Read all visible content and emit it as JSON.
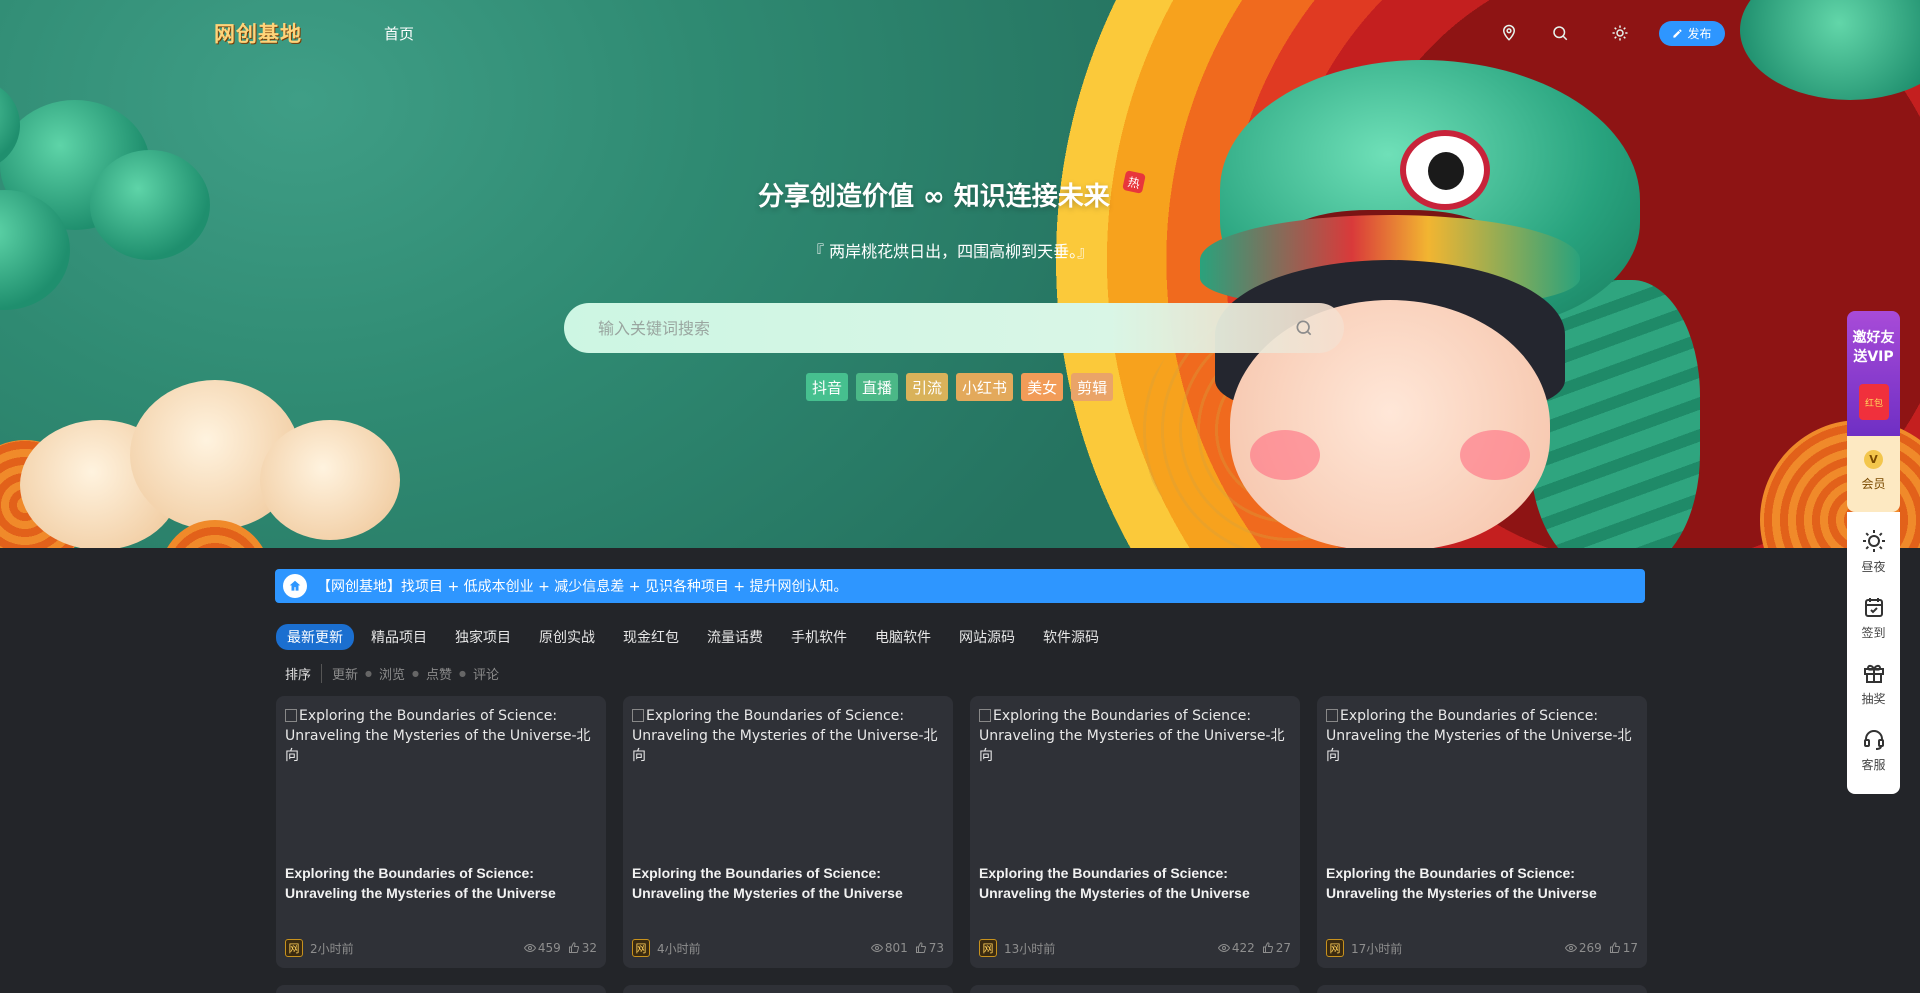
{
  "site": {
    "logo": "网创基地",
    "nav": {
      "home": "首页"
    },
    "publish_label": "发布",
    "publish_color": "#2e96ff"
  },
  "hero": {
    "title": "分享创造价值 ∞ 知识连接未来",
    "hot_badge": "热",
    "subtitle": "『 两岸桃花烘日出，四围高柳到天垂。』",
    "search_placeholder": "输入关键词搜索",
    "hot_tags": [
      {
        "label": "抖音",
        "color": "#46c08f"
      },
      {
        "label": "直播",
        "color": "#4bb887"
      },
      {
        "label": "引流",
        "color": "#d9b25a"
      },
      {
        "label": "小红书",
        "color": "#e3a95b"
      },
      {
        "label": "美女",
        "color": "#f29c58"
      },
      {
        "label": "剪辑",
        "color": "#eaa468"
      }
    ]
  },
  "notice": {
    "text": "【网创基地】找项目 + 低成本创业 + 减少信息差 + 见识各种项目 + 提升网创认知。",
    "icon": "home-icon"
  },
  "categories": [
    "最新更新",
    "精品项目",
    "独家项目",
    "原创实战",
    "现金红包",
    "流量话费",
    "手机软件",
    "电脑软件",
    "网站源码",
    "软件源码"
  ],
  "active_category": "最新更新",
  "sort": {
    "label": "排序",
    "options": [
      "更新",
      "浏览",
      "点赞",
      "评论"
    ]
  },
  "posts": [
    {
      "image_alt": "Exploring the Boundaries of Science: Unraveling the Mysteries of the Universe-北向",
      "title": "Exploring the Boundaries of Science: Unraveling the Mysteries of the Universe",
      "avatar": "网",
      "time": "2小时前",
      "views": "459",
      "likes": "32"
    },
    {
      "image_alt": "Exploring the Boundaries of Science: Unraveling the Mysteries of the Universe-北向",
      "title": "Exploring the Boundaries of Science: Unraveling the Mysteries of the Universe",
      "avatar": "网",
      "time": "4小时前",
      "views": "801",
      "likes": "73"
    },
    {
      "image_alt": "Exploring the Boundaries of Science: Unraveling the Mysteries of the Universe-北向",
      "title": "Exploring the Boundaries of Science: Unraveling the Mysteries of the Universe",
      "avatar": "网",
      "time": "13小时前",
      "views": "422",
      "likes": "27"
    },
    {
      "image_alt": "Exploring the Boundaries of Science: Unraveling the Mysteries of the Universe-北向",
      "title": "Exploring the Boundaries of Science: Unraveling the Mysteries of the Universe",
      "avatar": "网",
      "time": "17小时前",
      "views": "269",
      "likes": "17"
    }
  ],
  "sidebar": {
    "vip_promo": "邀好友送VIP",
    "vip_envelope": "红包",
    "member_badge": "V",
    "member": "会员",
    "items": [
      {
        "label": "昼夜",
        "icon": "sun-icon"
      },
      {
        "label": "签到",
        "icon": "calendar-icon"
      },
      {
        "label": "抽奖",
        "icon": "gift-icon"
      },
      {
        "label": "客服",
        "icon": "headset-icon"
      }
    ]
  }
}
